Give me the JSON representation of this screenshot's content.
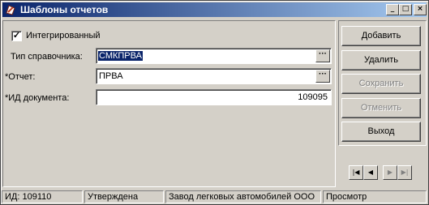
{
  "window": {
    "title": "Шаблоны отчетов",
    "controls": {
      "minimize": "_",
      "maximize": "□",
      "close": "×"
    }
  },
  "form": {
    "integrated": {
      "label": "Интегрированный",
      "checked": true,
      "mark": "✓"
    },
    "fields": [
      {
        "label": "Тип справочника:",
        "value": "СМКПРВА",
        "has_lookup": true
      },
      {
        "label": "*Отчет:",
        "value": "ПРВА",
        "has_lookup": true
      },
      {
        "label": "*ИД документа:",
        "value": "109095",
        "has_lookup": false
      }
    ],
    "lookup_label": "···"
  },
  "actions": {
    "add": "Добавить",
    "delete": "Удалить",
    "save": "Сохранить",
    "cancel": "Отменить",
    "exit": "Выход"
  },
  "navigation": {
    "first": "|◀",
    "prev": "◀",
    "next": "▶",
    "last": "▶|"
  },
  "status": {
    "id": "ИД: 109110",
    "state": "Утверждена",
    "org": "Завод легковых автомобилей ООО",
    "mode": "Просмотр"
  }
}
